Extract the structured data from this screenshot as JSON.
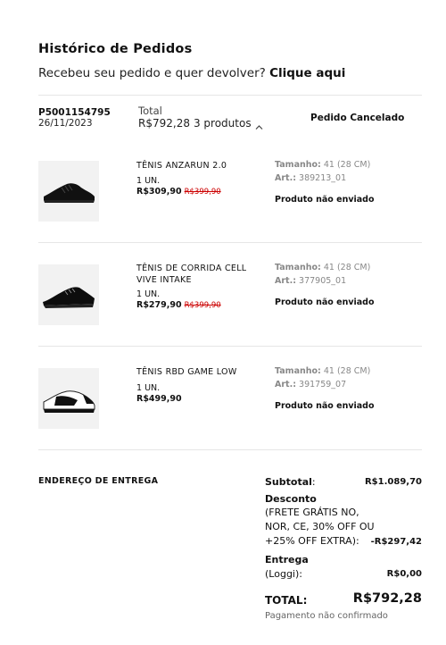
{
  "header": {
    "title": "Histórico de Pedidos",
    "return_question": "Recebeu seu pedido e quer devolver?",
    "return_link": "Clique aqui"
  },
  "order": {
    "id": "P5001154795",
    "date": "26/11/2023",
    "total_label": "Total",
    "total_value": "R$792,28",
    "items_count": "3 produtos",
    "status": "Pedido Cancelado",
    "items": [
      {
        "name": "TÊNIS ANZARUN 2.0",
        "qty": "1 UN.",
        "price": "R$309,90",
        "old_price": "R$399,90",
        "size_label": "Tamanho:",
        "size_value": "41 (28 CM)",
        "art_label": "Art.:",
        "art_value": "389213_01",
        "shipping": "Produto não enviado",
        "image_icon": "black-sneaker-icon"
      },
      {
        "name": "TÊNIS DE CORRIDA CELL VIVE INTAKE",
        "qty": "1 UN.",
        "price": "R$279,90",
        "old_price": "R$399,90",
        "size_label": "Tamanho:",
        "size_value": "41 (28 CM)",
        "art_label": "Art.:",
        "art_value": "377905_01",
        "shipping": "Produto não enviado",
        "image_icon": "black-running-shoe-icon"
      },
      {
        "name": "TÊNIS RBD GAME LOW",
        "qty": "1 UN.",
        "price": "R$499,90",
        "old_price": "",
        "size_label": "Tamanho:",
        "size_value": "41 (28 CM)",
        "art_label": "Art.:",
        "art_value": "391759_07",
        "shipping": "Produto não enviado",
        "image_icon": "white-black-sneaker-icon"
      }
    ]
  },
  "address": {
    "label": "ENDEREÇO DE ENTREGA"
  },
  "summary": {
    "subtotal_label": "Subtotal",
    "subtotal_value": "R$1.089,70",
    "discount_label": "Desconto",
    "discount_desc_1": "(FRETE GRÁTIS NO,",
    "discount_desc_2": "NOR, CE, 30% OFF OU",
    "discount_desc_3": "+25% OFF EXTRA):",
    "discount_value": "-R$297,42",
    "delivery_label": "Entrega",
    "delivery_method": "(Loggi):",
    "delivery_value": "R$0,00",
    "total_label": "TOTAL",
    "total_value": "R$792,28",
    "payment_note": "Pagamento não confirmado"
  },
  "colors": {
    "strike_red": "#cc0000",
    "muted_gray": "#888888",
    "divider": "#e6e6e6"
  }
}
